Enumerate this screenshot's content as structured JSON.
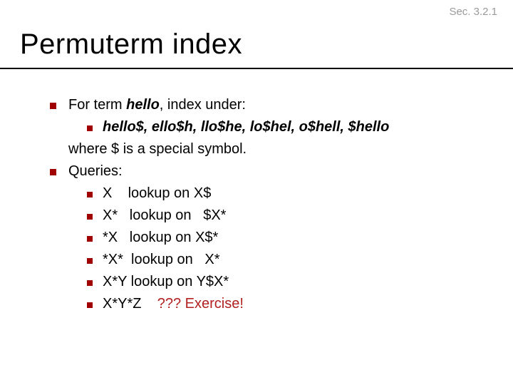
{
  "section_label": "Sec. 3.2.1",
  "title": "Permuterm index",
  "b1": {
    "pre": "For term ",
    "term": "hello",
    "post": ", index under:",
    "sub1": "hello$, ello$h, llo$he, lo$hel, o$hell, $hello",
    "where": "where $ is a special symbol."
  },
  "b2": {
    "label": "Queries:",
    "rows": {
      "r1": "X    lookup on X$",
      "r2": "X*   lookup on   $X*",
      "r3": "*X   lookup on X$*",
      "r4": "*X*  lookup on   X*",
      "r5": "X*Y lookup on Y$X*",
      "r6a": "X*Y*Z    ",
      "r6b": "??? Exercise!"
    }
  }
}
